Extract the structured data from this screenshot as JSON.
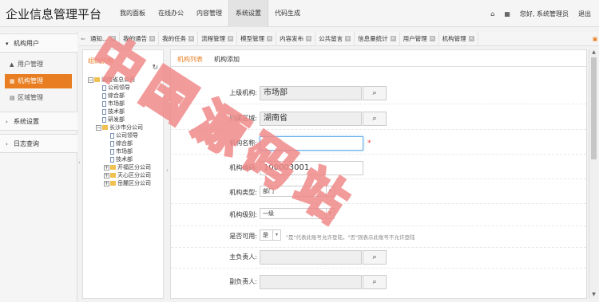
{
  "app": {
    "title": "企业信息管理平台"
  },
  "topnav": {
    "items": [
      "我的面板",
      "在线办公",
      "内容管理",
      "系统设置",
      "代码生成"
    ],
    "active": 3
  },
  "user": {
    "greeting": "您好, 系统管理员",
    "logout": "退出"
  },
  "sidebar": {
    "group1": "机构用户",
    "items": [
      {
        "label": "用户管理",
        "icon": "user-icon"
      },
      {
        "label": "机构管理",
        "icon": "grid-icon"
      },
      {
        "label": "区域管理",
        "icon": "list-icon"
      }
    ],
    "group2": "系统设置",
    "group3": "日志查询"
  },
  "tabs": [
    "通知...",
    "我的通告",
    "我的任务",
    "流程管理",
    "模型管理",
    "内容发布",
    "公共留言",
    "信息量统计",
    "用户管理",
    "机构管理"
  ],
  "tree": {
    "title": "组织机构",
    "nodes": [
      "湖南省总公司",
      "公司领导",
      "综合部",
      "市场部",
      "技术部",
      "研发部",
      "长沙市分公司",
      "公司领导",
      "综合部",
      "市场部",
      "技术部",
      "开福区分公司",
      "天心区分公司",
      "岳麓区分公司"
    ]
  },
  "subtabs": {
    "list": "机构列表",
    "add": "机构添加"
  },
  "form": {
    "parent_label": "上级机构:",
    "parent_value": "市场部",
    "area_label": "归属区域:",
    "area_value": "湖南省",
    "name_label": "机构名称:",
    "name_value": "",
    "code_label": "机构编码:",
    "code_value": "100003001",
    "type_label": "机构类型:",
    "type_value": "部门",
    "grade_label": "机构级别:",
    "grade_value": "一级",
    "useable_label": "是否可用:",
    "useable_value": "是",
    "useable_hint": "\"是\"代表此账号允许登陆，\"否\"则表示此账号不允许登陆",
    "primary_label": "主负责人:",
    "deputy_label": "副负责人:"
  },
  "watermark": {
    "text": "中国源码站"
  },
  "colors": {
    "accent": "#e87e21",
    "watermark": "#f08a8a"
  }
}
